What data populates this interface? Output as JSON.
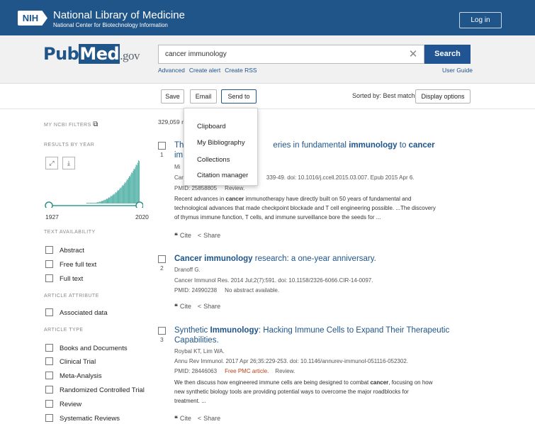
{
  "header": {
    "nih_logo": "NIH",
    "title": "National Library of Medicine",
    "subtitle": "National Center for Biotechnology Information",
    "login_label": "Log in"
  },
  "search": {
    "logo_pub": "Pub",
    "logo_med": "Med",
    "logo_gov": ".gov",
    "query": "cancer immunology",
    "clear_icon": "close-icon",
    "button_label": "Search",
    "links": [
      "Advanced",
      "Create alert",
      "Create RSS"
    ],
    "user_guide": "User Guide"
  },
  "toolbar": {
    "save_label": "Save",
    "email_label": "Email",
    "send_to_label": "Send to",
    "sorted_by": "Sorted by: Best match",
    "display_options": "Display options"
  },
  "send_to_menu": {
    "items": [
      "Clipboard",
      "My Bibliography",
      "Collections",
      "Citation manager"
    ]
  },
  "sidebar": {
    "my_filters": "MY NCBI FILTERS",
    "results_by_year": "RESULTS BY YEAR",
    "year_start": "1927",
    "year_end": "2020",
    "text_availability": "TEXT AVAILABILITY",
    "text_filters": [
      "Abstract",
      "Free full text",
      "Full text"
    ],
    "article_attribute": "ARTICLE ATTRIBUTE",
    "attribute_filters": [
      "Associated data"
    ],
    "article_type": "ARTICLE TYPE",
    "type_filters": [
      "Books and Documents",
      "Clinical Trial",
      "Meta-Analysis",
      "Randomized Controlled Trial",
      "Review",
      "Systematic Reviews"
    ]
  },
  "results": {
    "count": "329,059 r",
    "items": [
      {
        "number": "1",
        "title_a": "Th",
        "title_b": "eries in fundamental ",
        "title_bold1": "immunology",
        "title_c": " to ",
        "title_bold2": "cancer",
        "title_line2": "im",
        "authors": "Mi",
        "citation_a": "Car",
        "citation_b": "339-49. doi: 10.1016/j.ccell.2015.03.007. Epub 2015 Apr 6.",
        "pmid": "PMID: 25858805",
        "type": "Review.",
        "snippet_1a": "Recent advances in ",
        "snippet_1b": "cancer",
        "snippet_1c": " immunotherapy have directly built on 50 years of fundamental and",
        "snippet_2": "technological advances that made checkpoint blockade and T cell engineering possible. ...The discovery",
        "snippet_3": "of thymus immune function, T cells, and immune surveillance bore the seeds for ..."
      },
      {
        "number": "2",
        "title_bold": "Cancer immunology",
        "title_rest": " research: a one-year anniversary.",
        "authors": "Dranoff G.",
        "citation": "Cancer Immunol Res. 2014 Jul;2(7):591. doi: 10.1158/2326-6066.CIR-14-0097.",
        "pmid": "PMID: 24990238",
        "note": "No abstract available."
      },
      {
        "number": "3",
        "title_a": "Synthetic ",
        "title_bold": "Immunology",
        "title_rest": ": Hacking Immune Cells to Expand Their Therapeutic",
        "title_line2": "Capabilities.",
        "authors": "Roybal KT, Lim WA.",
        "citation": "Annu Rev Immunol. 2017 Apr 26;35:229-253. doi: 10.1146/annurev-immunol-051116-052302.",
        "pmid": "PMID: 28446063",
        "free": "Free PMC article.",
        "type": "Review.",
        "snippet_1a": "We then discuss how engineered immune cells are being designed to combat ",
        "snippet_1b": "cancer",
        "snippet_1c": ", focusing on how",
        "snippet_2": "new synthetic biology tools are providing potential ways to overcome the major roadblocks for",
        "snippet_3": "treatment. ..."
      }
    ],
    "cite_label": "Cite",
    "share_label": "Share"
  },
  "colors": {
    "brand": "#20558a",
    "histogram": "#5fb7ad",
    "free_pmc": "#b5421a"
  }
}
